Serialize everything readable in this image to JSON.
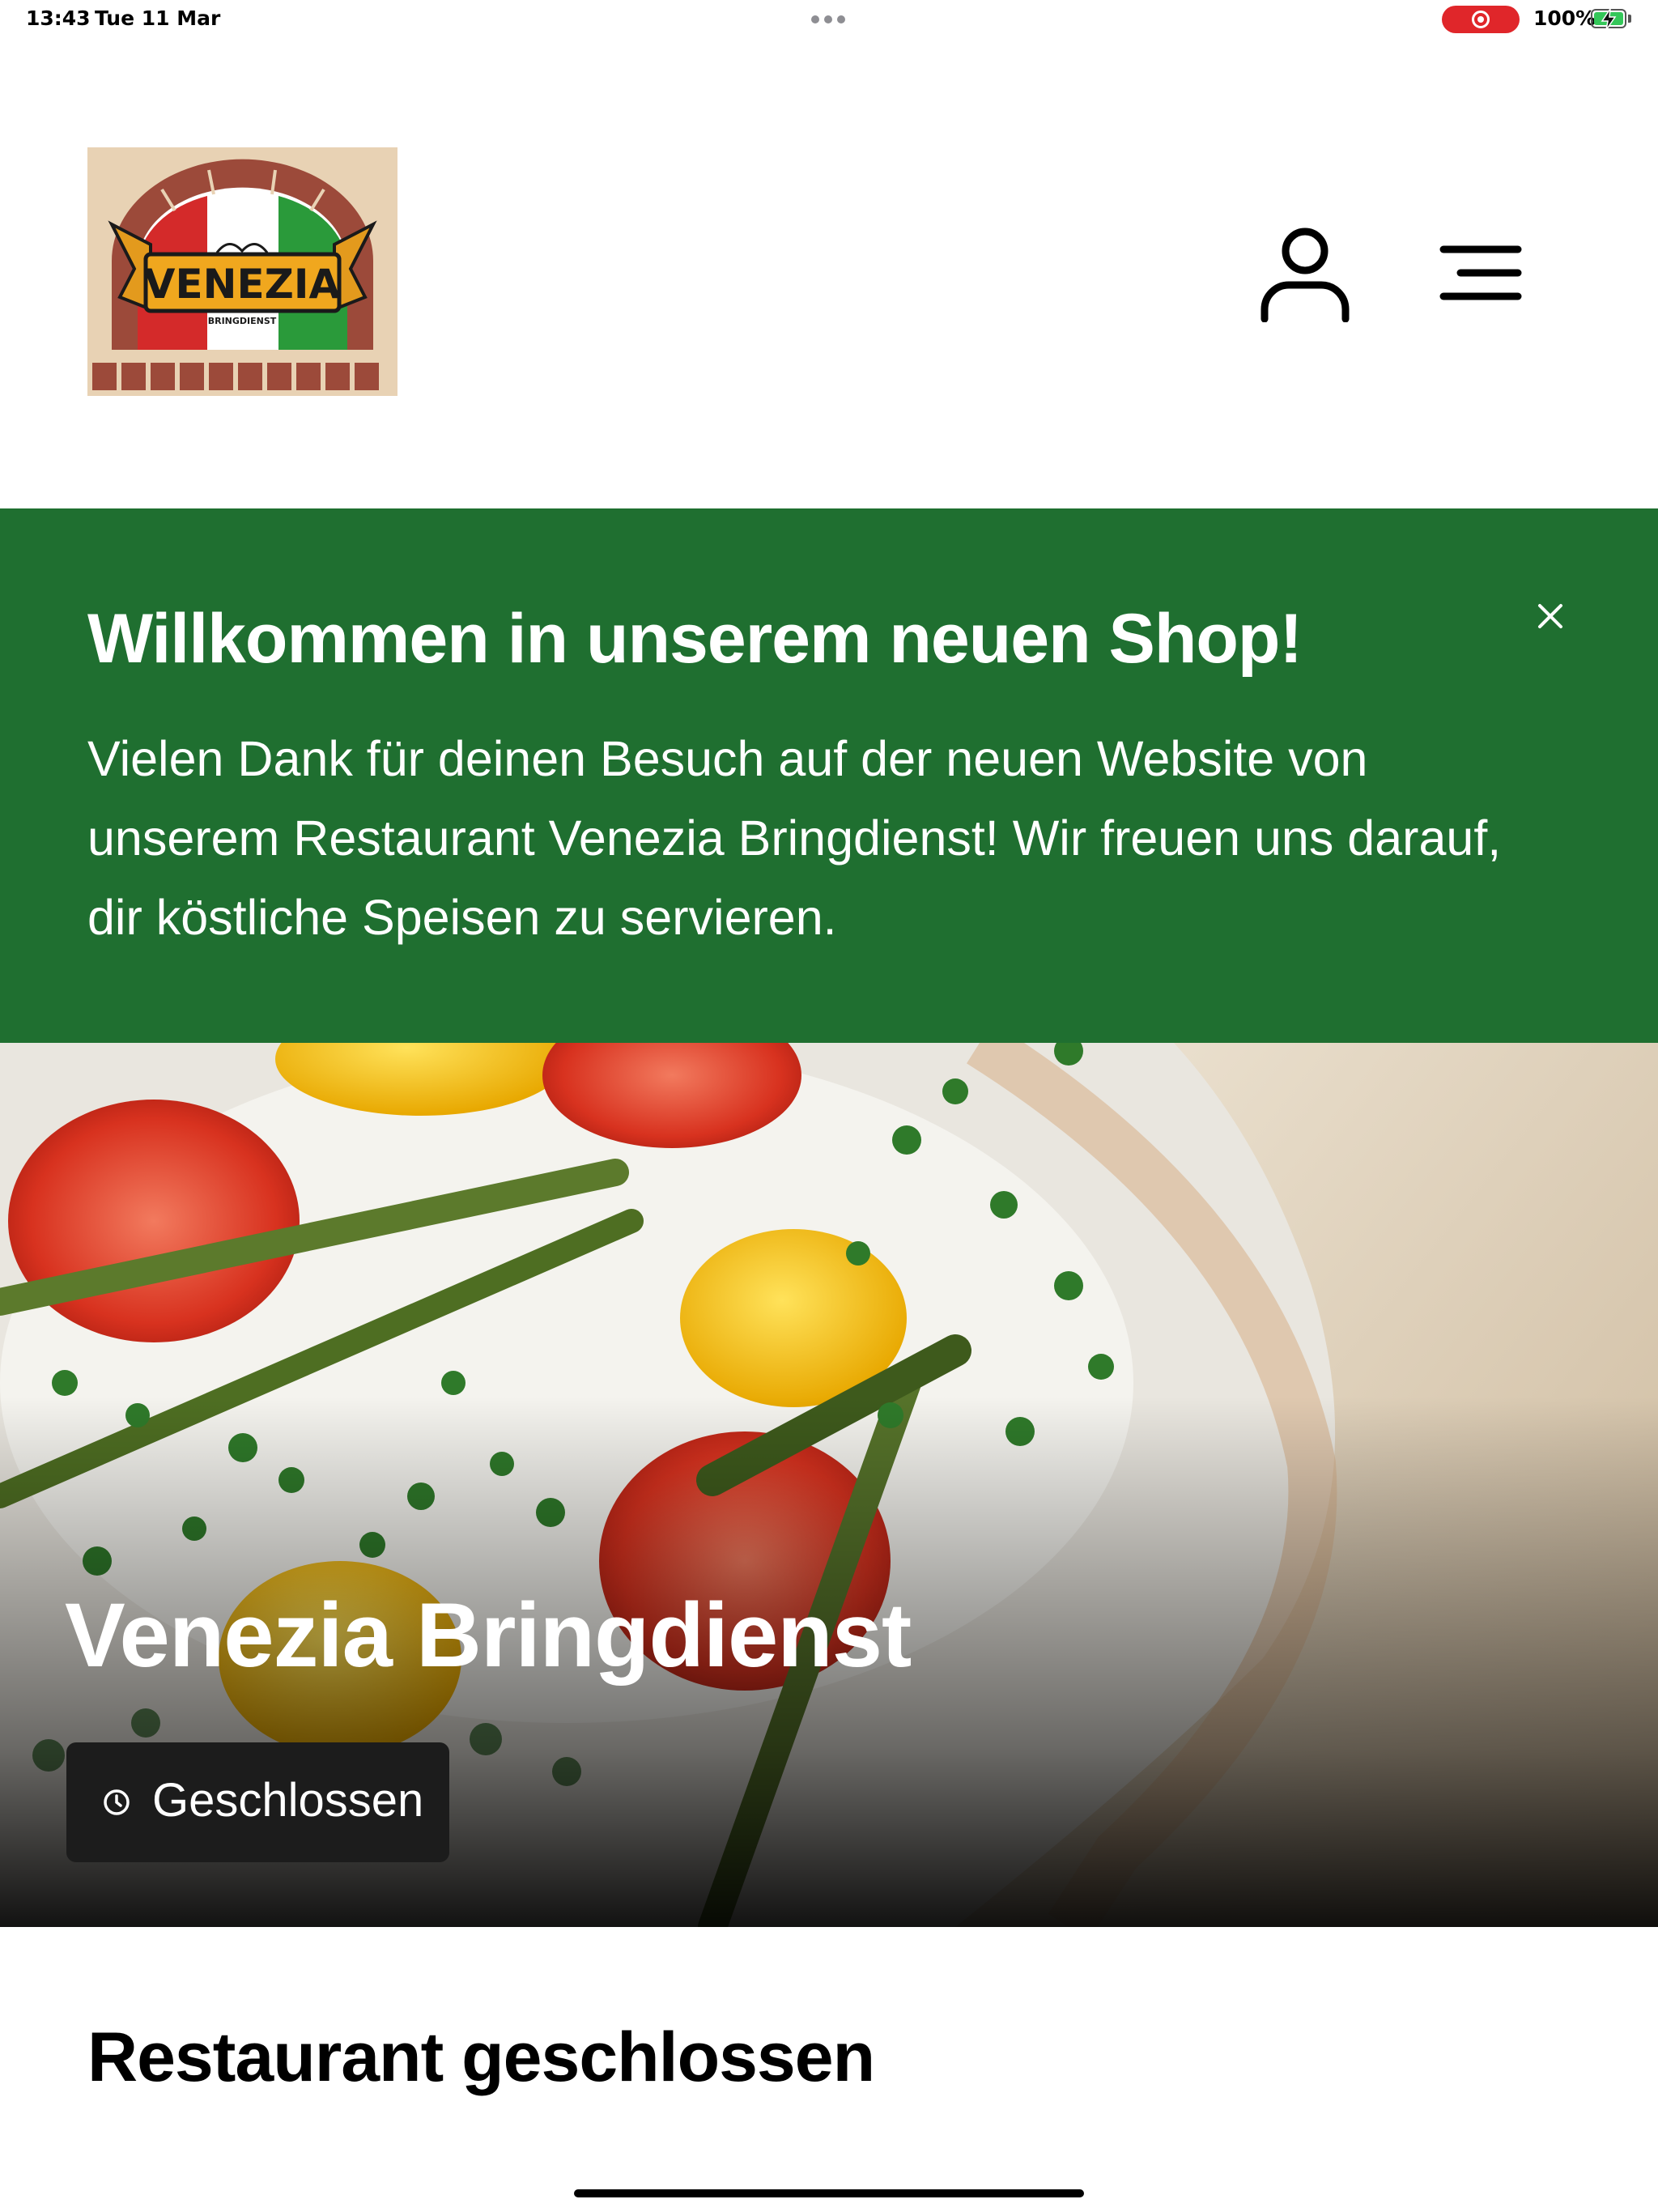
{
  "status_bar": {
    "time": "13:43",
    "date": "Tue 11 Mar",
    "battery": "100%"
  },
  "header": {
    "logo_text": "VENEZIA",
    "logo_subtext": "BRINGDIENST",
    "user_icon": "user-icon",
    "menu_icon": "hamburger-menu-icon"
  },
  "banner": {
    "title": "Willkommen in unserem neuen Shop!",
    "text": "Vielen Dank für deinen Besuch auf der neuen Website von unserem Restaurant Venezia Bringdienst! Wir freuen uns darauf, dir köstliche Speisen zu servieren.",
    "close_icon": "close-icon",
    "background_color": "#1f6f30"
  },
  "hero": {
    "title": "Venezia Bringdienst",
    "status_label": "Geschlossen",
    "status_icon": "clock-icon"
  },
  "main": {
    "heading": "Restaurant geschlossen"
  }
}
